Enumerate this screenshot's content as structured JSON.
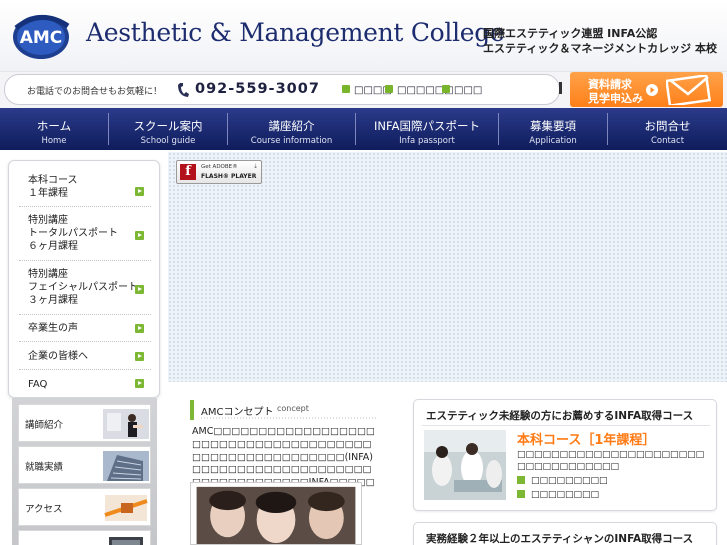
{
  "header": {
    "logo_text": "AMC",
    "title": "Aesthetic & Management College",
    "subtitle_line1": "国際エステティック連盟 INFA公認",
    "subtitle_line2": "エステティック＆マネージメントカレッジ 本校"
  },
  "infobar": {
    "lead": "お電話でのお問合せもお気軽に！",
    "phone": "092-559-3007",
    "links": [
      "□□□□",
      "□□□□□□",
      "□□□"
    ],
    "request_line1": "資料請求",
    "request_line2": "見学申込み"
  },
  "nav": [
    {
      "jp": "ホーム",
      "en": "Home"
    },
    {
      "jp": "スクール案内",
      "en": "School guide"
    },
    {
      "jp": "講座紹介",
      "en": "Course information"
    },
    {
      "jp": "INFA国際パスポート",
      "en": "Infa passport"
    },
    {
      "jp": "募集要項",
      "en": "Application"
    },
    {
      "jp": "お問合せ",
      "en": "Contact"
    }
  ],
  "flash": {
    "get": "Get ADOBE®",
    "player": "FLASH® PLAYER"
  },
  "sidebar": {
    "items": [
      {
        "lines": [
          "本科コース",
          "１年課程"
        ]
      },
      {
        "lines": [
          "特別講座",
          "トータルパスポート",
          "６ヶ月課程"
        ]
      },
      {
        "lines": [
          "特別講座",
          "フェイシャルパスポート",
          "３ヶ月課程"
        ]
      },
      {
        "lines": [
          "卒業生の声"
        ]
      },
      {
        "lines": [
          "企業の皆様へ"
        ]
      },
      {
        "lines": [
          "FAQ"
        ]
      }
    ],
    "lower": [
      "講師紹介",
      "就職実績",
      "アクセス"
    ]
  },
  "concept": {
    "title": "AMCコンセプト",
    "sub": "concept",
    "text": "AMC□□□□□□□□□□□□□□□□□□□□□□□□□□□□□□□□□□□□□□□□□□□□□□□□□□□□□□□(INFA)□□□□□□□□□□□□□□□□□□□□□□□□□□□□□□□□□INFA□□□□□□□□□□□□□□□□□□□"
  },
  "courses": [
    {
      "head": "エステティック未経験の方にお薦めするINFA取得コース",
      "title": "本科コース［1年課程］",
      "desc": "□□□□□□□□□□□□□□□□□□□□□□□□□□□□□□□□□□",
      "links": [
        "□□□□□□□□□",
        "□□□□□□□□"
      ]
    },
    {
      "head": "実務経験２年以上のエステティシャンのINFA取得コース"
    }
  ],
  "colors": {
    "navy": "#1c2c6e",
    "nav_bg": "#1a2a70",
    "accent_green": "#7cb833",
    "accent_orange": "#ff7b16"
  }
}
